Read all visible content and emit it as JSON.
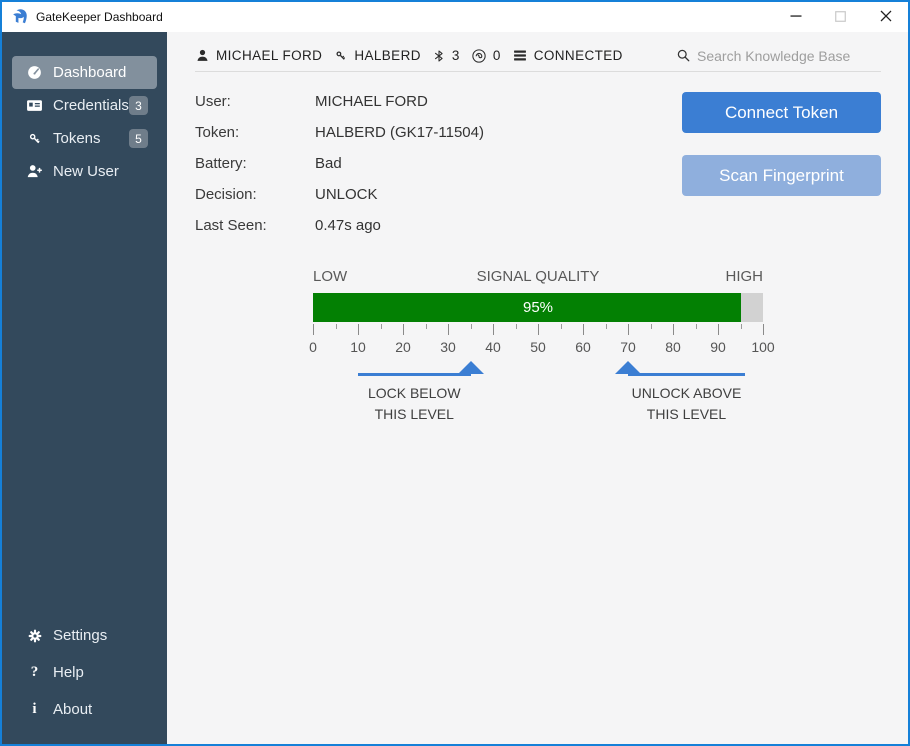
{
  "window": {
    "title": "GateKeeper Dashboard"
  },
  "colors": {
    "accent_blue": "#3b7ed3",
    "sidebar_bg": "#33495c",
    "signal_green": "#038003",
    "window_border": "#1580d8",
    "disabled_button": "#8fafdd"
  },
  "sidebar": {
    "items": [
      {
        "label": "Dashboard",
        "active": true
      },
      {
        "label": "Credentials",
        "badge": "3"
      },
      {
        "label": "Tokens",
        "badge": "5"
      },
      {
        "label": "New User"
      }
    ],
    "footer_items": [
      {
        "label": "Settings"
      },
      {
        "label": "Help",
        "icon_glyph": "?"
      },
      {
        "label": "About",
        "icon_glyph": "i"
      }
    ]
  },
  "statusbar": {
    "user": "MICHAEL FORD",
    "token": "HALBERD",
    "bluetooth_count": "3",
    "fingerprint_count": "0",
    "connection": "CONNECTED",
    "search_placeholder": "Search Knowledge Base"
  },
  "details": {
    "rows": [
      {
        "label": "User:",
        "value": "MICHAEL FORD"
      },
      {
        "label": "Token:",
        "value": "HALBERD (GK17-11504)"
      },
      {
        "label": "Battery:",
        "value": "Bad"
      },
      {
        "label": "Decision:",
        "value": "UNLOCK"
      },
      {
        "label": "Last Seen:",
        "value": "0.47s ago"
      }
    ]
  },
  "actions": {
    "connect_token": "Connect Token",
    "scan_fingerprint": "Scan Fingerprint"
  },
  "signal": {
    "title": "SIGNAL QUALITY",
    "low_label": "LOW",
    "high_label": "HIGH",
    "value": 95,
    "value_label": "95%",
    "scale": {
      "min": 0,
      "max": 100,
      "major_step": 10,
      "minor_step": 5,
      "major_tick_labels": [
        0,
        10,
        20,
        30,
        40,
        50,
        60,
        70,
        80,
        90,
        100
      ]
    },
    "lock_threshold": {
      "value": 35,
      "line_from": 10,
      "label_line1": "LOCK BELOW",
      "label_line2": "THIS LEVEL"
    },
    "unlock_threshold": {
      "value": 70,
      "line_to": 96,
      "label_line1": "UNLOCK ABOVE",
      "label_line2": "THIS LEVEL"
    }
  }
}
